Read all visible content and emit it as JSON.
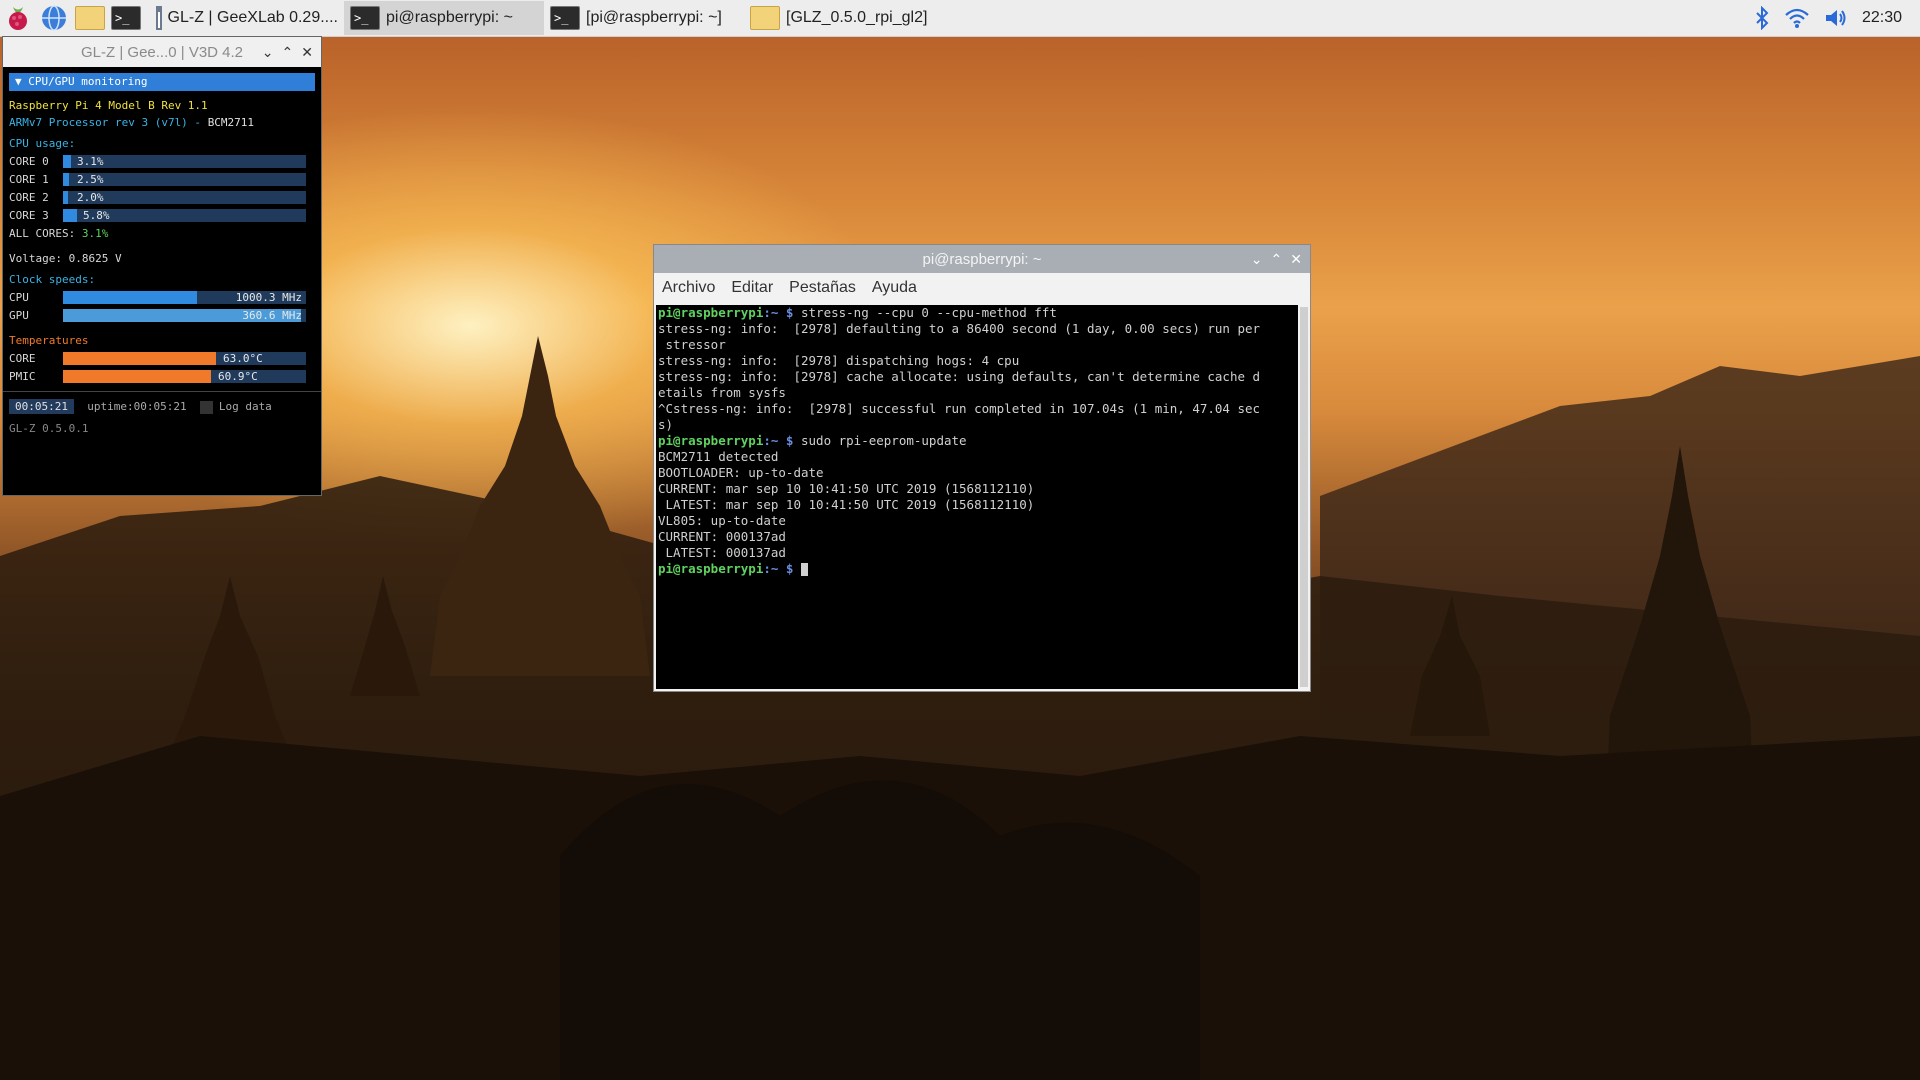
{
  "taskbar": {
    "tasks": [
      {
        "label": "GL-Z | GeeXLab 0.29....",
        "icon": "window-icon"
      },
      {
        "label": "pi@raspberrypi: ~",
        "icon": "terminal-icon"
      },
      {
        "label": "[pi@raspberrypi: ~]",
        "icon": "terminal-icon"
      },
      {
        "label": "[GLZ_0.5.0_rpi_gl2]",
        "icon": "folder-icon"
      }
    ],
    "clock": "22:30"
  },
  "glz": {
    "title": "GL-Z | Gee...0 | V3D 4.2",
    "section_header": "CPU/GPU monitoring",
    "board": "Raspberry Pi 4 Model B Rev 1.1",
    "processor_name": "ARMv7 Processor rev 3 (v7l)",
    "processor_chip": "BCM2711",
    "cpu_usage_label": "CPU usage:",
    "cores": [
      {
        "label": "CORE  0",
        "value": "3.1%",
        "fraction": 0.031
      },
      {
        "label": "CORE  1",
        "value": "2.5%",
        "fraction": 0.025
      },
      {
        "label": "CORE  2",
        "value": "2.0%",
        "fraction": 0.02
      },
      {
        "label": "CORE  3",
        "value": "5.8%",
        "fraction": 0.058
      }
    ],
    "all_cores_label": "ALL CORES:",
    "all_cores_value": "3.1%",
    "voltage": "Voltage: 0.8625 V",
    "clock_label": "Clock speeds:",
    "clocks": [
      {
        "label": "CPU",
        "value": "1000.3 MHz",
        "fraction": 0.55
      },
      {
        "label": "GPU",
        "value": "360.6 MHz",
        "fraction": 0.98
      }
    ],
    "temps_label": "Temperatures",
    "temps": [
      {
        "label": "CORE",
        "value": "63.0°C",
        "fraction": 0.63
      },
      {
        "label": "PMIC",
        "value": "60.9°C",
        "fraction": 0.61
      }
    ],
    "timer": "00:05:21",
    "uptime": "uptime:00:05:21",
    "log_label": "Log data",
    "version": "GL-Z 0.5.0.1"
  },
  "terminal": {
    "title": "pi@raspberrypi: ~",
    "menu": [
      "Archivo",
      "Editar",
      "Pestañas",
      "Ayuda"
    ],
    "prompt_user": "pi@raspberrypi",
    "prompt_path": ":~ $",
    "lines": [
      {
        "type": "cmd",
        "text": "stress-ng --cpu 0 --cpu-method fft"
      },
      {
        "type": "out",
        "text": "stress-ng: info:  [2978] defaulting to a 86400 second (1 day, 0.00 secs) run per"
      },
      {
        "type": "out",
        "text": " stressor"
      },
      {
        "type": "out",
        "text": "stress-ng: info:  [2978] dispatching hogs: 4 cpu"
      },
      {
        "type": "out",
        "text": "stress-ng: info:  [2978] cache allocate: using defaults, can't determine cache d"
      },
      {
        "type": "out",
        "text": "etails from sysfs"
      },
      {
        "type": "out",
        "text": "^Cstress-ng: info:  [2978] successful run completed in 107.04s (1 min, 47.04 sec"
      },
      {
        "type": "out",
        "text": "s)"
      },
      {
        "type": "cmd",
        "text": "sudo rpi-eeprom-update"
      },
      {
        "type": "out",
        "text": "BCM2711 detected"
      },
      {
        "type": "out",
        "text": "BOOTLOADER: up-to-date"
      },
      {
        "type": "out",
        "text": "CURRENT: mar sep 10 10:41:50 UTC 2019 (1568112110)"
      },
      {
        "type": "out",
        "text": " LATEST: mar sep 10 10:41:50 UTC 2019 (1568112110)"
      },
      {
        "type": "out",
        "text": "VL805: up-to-date"
      },
      {
        "type": "out",
        "text": "CURRENT: 000137ad"
      },
      {
        "type": "out",
        "text": " LATEST: 000137ad"
      },
      {
        "type": "cmd",
        "text": ""
      }
    ]
  }
}
